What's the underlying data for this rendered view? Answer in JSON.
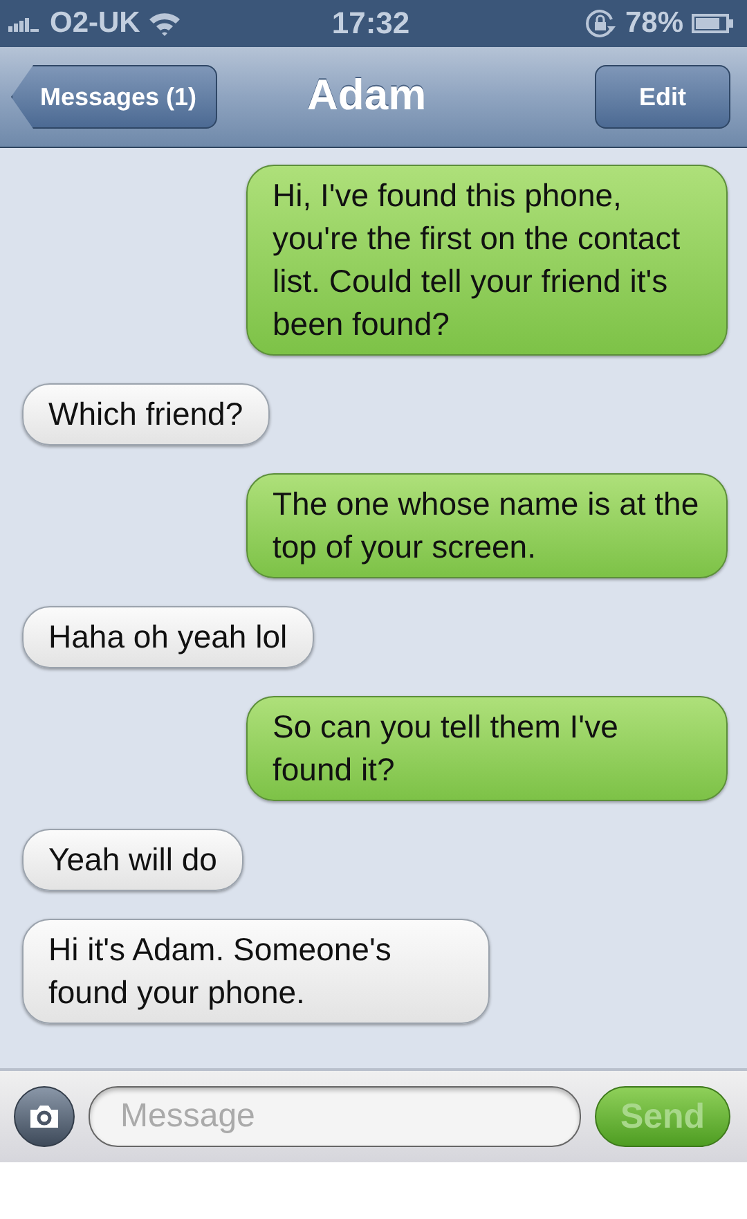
{
  "status_bar": {
    "carrier": "O2-UK",
    "time": "17:32",
    "battery": "78%"
  },
  "nav_bar": {
    "back_button": "Messages (1)",
    "title": "Adam",
    "edit_button": "Edit"
  },
  "messages": [
    {
      "kind": "sent",
      "text": "Hi, I've found this phone, you're the first on the contact list. Could tell your friend it's been found?"
    },
    {
      "kind": "received",
      "text": "Which friend?"
    },
    {
      "kind": "sent",
      "text": "The one whose name is at the top of your screen."
    },
    {
      "kind": "received",
      "text": "Haha oh yeah lol"
    },
    {
      "kind": "sent",
      "text": "So can you tell them I've found it?"
    },
    {
      "kind": "received",
      "text": "Yeah will do"
    },
    {
      "kind": "received",
      "text": "Hi it's Adam. Someone's found your phone."
    }
  ],
  "compose_bar": {
    "placeholder": "Message",
    "send_button": "Send",
    "send_disabled": true
  }
}
